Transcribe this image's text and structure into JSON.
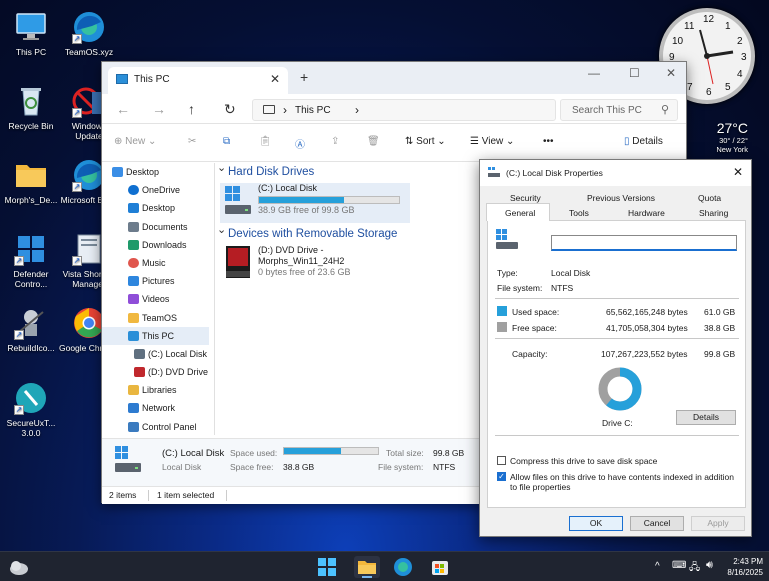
{
  "desktop": {
    "icons": [
      {
        "label": "This PC"
      },
      {
        "label": "TeamOS.xyz"
      },
      {
        "label": "Recycle Bin"
      },
      {
        "label": "Windows Update"
      },
      {
        "label": "Morph's_De..."
      },
      {
        "label": "Microsoft Edge"
      },
      {
        "label": "Defender Contro..."
      },
      {
        "label": "Vista Shortcut Manager"
      },
      {
        "label": "RebuildIco..."
      },
      {
        "label": "Google Chrome"
      },
      {
        "label": "SecureUxT... 3.0.0"
      }
    ],
    "clock_numbers": [
      "12",
      "1",
      "2",
      "3",
      "4",
      "5",
      "6",
      "7",
      "8",
      "9",
      "10",
      "11"
    ],
    "weather": {
      "temp": "27°C",
      "range": "30° / 22°",
      "city": "New York"
    }
  },
  "explorer": {
    "tab_title": "This PC",
    "tab_close": "✕",
    "new_tab": "+",
    "window_controls": {
      "minimize": "—",
      "maximize": "☐",
      "close": "✕"
    },
    "nav": {
      "back": "←",
      "forward": "→",
      "up": "↑",
      "refresh": "↻"
    },
    "address": {
      "chevron": "›",
      "location": "This PC"
    },
    "search_placeholder": "Search This PC",
    "toolbar": {
      "new": "New",
      "sort": "Sort",
      "view": "View",
      "more": "•••",
      "details": "Details"
    },
    "sidebar": [
      {
        "label": "Desktop",
        "color": "#3a8ee6"
      },
      {
        "label": "OneDrive",
        "color": "#0f6fd0"
      },
      {
        "label": "Desktop",
        "color": "#1f7fd6"
      },
      {
        "label": "Documents",
        "color": "#6d7c8c"
      },
      {
        "label": "Downloads",
        "color": "#1f9a6a"
      },
      {
        "label": "Music",
        "color": "#e0564d"
      },
      {
        "label": "Pictures",
        "color": "#2e86de"
      },
      {
        "label": "Videos",
        "color": "#8f4ed8"
      },
      {
        "label": "TeamOS",
        "color": "#f0b840"
      },
      {
        "label": "This PC",
        "color": "#2b8fd8"
      },
      {
        "label": "(C:) Local Disk",
        "color": "#607080"
      },
      {
        "label": "(D:) DVD Drive",
        "color": "#c0282d"
      },
      {
        "label": "Libraries",
        "color": "#e9b640"
      },
      {
        "label": "Network",
        "color": "#2d7bd0"
      },
      {
        "label": "Control Panel",
        "color": "#3b7bbf"
      }
    ],
    "groups": {
      "hard_disk": "Hard Disk Drives",
      "removable": "Devices with Removable Storage"
    },
    "drives": {
      "c": {
        "name": "(C:) Local Disk",
        "free": "38.9 GB free of 99.8 GB",
        "used_fraction": 0.61
      },
      "d": {
        "name_line1": "(D:) DVD Drive -",
        "name_line2": "Morphs_Win11_24H2",
        "free": "0 bytes free of 23.6 GB"
      }
    },
    "details": {
      "name": "(C:) Local Disk",
      "type": "Local Disk",
      "space_used_label": "Space used:",
      "space_free_label": "Space free:",
      "space_free": "38.8 GB",
      "total_label": "Total size:",
      "total": "99.8 GB",
      "fs_label": "File system:",
      "fs": "NTFS",
      "used_fraction": 0.61
    },
    "status": {
      "items": "2 items",
      "selected": "1 item selected"
    }
  },
  "properties": {
    "title": "(C:) Local Disk Properties",
    "close": "✕",
    "tabs_row1": [
      "Security",
      "Previous Versions",
      "Quota"
    ],
    "tabs_row2": [
      "General",
      "Tools",
      "Hardware",
      "Sharing"
    ],
    "name_value": "",
    "type_label": "Type:",
    "type_value": "Local Disk",
    "fs_label": "File system:",
    "fs_value": "NTFS",
    "used_label": "Used space:",
    "used_bytes": "65,562,165,248 bytes",
    "used_gb": "61.0 GB",
    "free_label": "Free space:",
    "free_bytes": "41,705,058,304 bytes",
    "free_gb": "38.8 GB",
    "cap_label": "Capacity:",
    "cap_bytes": "107,267,223,552 bytes",
    "cap_gb": "99.8 GB",
    "drive_label": "Drive C:",
    "details_btn": "Details",
    "compress": "Compress this drive to save disk space",
    "index": "Allow files on this drive to have contents indexed in addition to file properties",
    "compress_checked": false,
    "index_checked": true,
    "used_color": "#26a0da",
    "free_color": "#a0a0a0",
    "used_fraction": 0.611,
    "ok": "OK",
    "cancel": "Cancel",
    "apply": "Apply"
  },
  "taskbar": {
    "time": "2:43 PM",
    "date": "8/16/2025",
    "tray_chevron": "^"
  }
}
